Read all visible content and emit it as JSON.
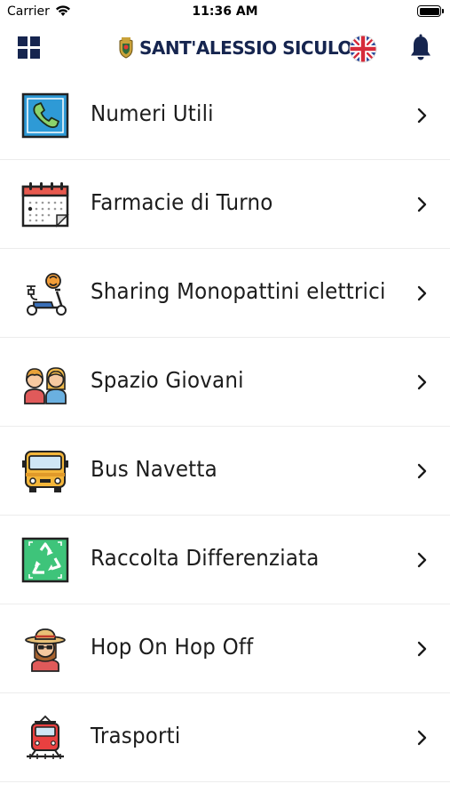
{
  "status_bar": {
    "carrier": "Carrier",
    "time": "11:36 AM"
  },
  "header": {
    "title": "SANT'ALESSIO SICULO",
    "menu_icon": "grid-icon",
    "language_icon": "uk-flag-icon",
    "notifications_icon": "bell-icon",
    "brand_color": "#16254f"
  },
  "menu": {
    "items": [
      {
        "label": "Numeri Utili",
        "icon": "phone-icon"
      },
      {
        "label": "Farmacie di Turno",
        "icon": "calendar-icon"
      },
      {
        "label": "Sharing Monopattini elettrici",
        "icon": "e-scooter-icon"
      },
      {
        "label": "Spazio Giovani",
        "icon": "young-people-icon"
      },
      {
        "label": "Bus Navetta",
        "icon": "bus-icon"
      },
      {
        "label": "Raccolta Differenziata",
        "icon": "recycle-icon"
      },
      {
        "label": "Hop On Hop Off",
        "icon": "tourist-icon"
      },
      {
        "label": "Trasporti",
        "icon": "train-icon"
      }
    ]
  }
}
